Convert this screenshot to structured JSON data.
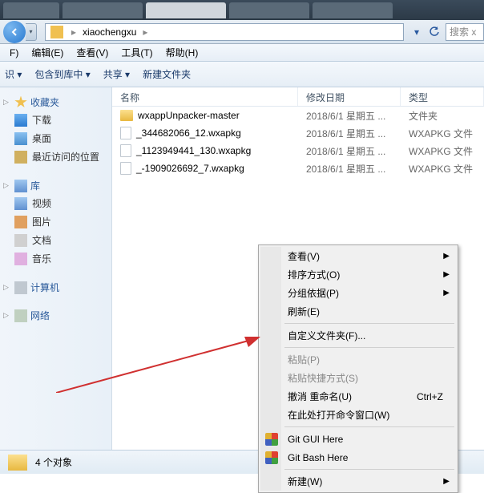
{
  "browser_tabs": [
    "",
    "",
    "",
    ""
  ],
  "breadcrumb": {
    "segment": "xiaochengxu",
    "sep": "▸"
  },
  "search_placeholder": "搜索 x",
  "menubar": [
    "F)",
    "编辑(E)",
    "查看(V)",
    "工具(T)",
    "帮助(H)"
  ],
  "toolbar": {
    "organize": "识 ▾",
    "include": "包含到库中 ▾",
    "share": "共享 ▾",
    "new_folder": "新建文件夹"
  },
  "sidebar": {
    "favorites": {
      "label": "收藏夹",
      "items": [
        "下载",
        "桌面",
        "最近访问的位置"
      ]
    },
    "libraries": {
      "label": "库",
      "items": [
        "视频",
        "图片",
        "文档",
        "音乐"
      ]
    },
    "computer": {
      "label": "计算机"
    },
    "network": {
      "label": "网络"
    }
  },
  "columns": {
    "name": "名称",
    "date": "修改日期",
    "type": "类型"
  },
  "files": [
    {
      "name": "wxappUnpacker-master",
      "date": "2018/6/1 星期五 ...",
      "type": "文件夹",
      "icon": "folder"
    },
    {
      "name": "_344682066_12.wxapkg",
      "date": "2018/6/1 星期五 ...",
      "type": "WXAPKG 文件",
      "icon": "file"
    },
    {
      "name": "_1123949441_130.wxapkg",
      "date": "2018/6/1 星期五 ...",
      "type": "WXAPKG 文件",
      "icon": "file"
    },
    {
      "name": "_-1909026692_7.wxapkg",
      "date": "2018/6/1 星期五 ...",
      "type": "WXAPKG 文件",
      "icon": "file"
    }
  ],
  "status": "4 个对象",
  "context_menu": {
    "view": "查看(V)",
    "sort": "排序方式(O)",
    "group": "分组依据(P)",
    "refresh": "刷新(E)",
    "customize": "自定义文件夹(F)...",
    "paste": "粘贴(P)",
    "paste_shortcut": "粘贴快捷方式(S)",
    "undo": "撤消 重命名(U)",
    "undo_key": "Ctrl+Z",
    "open_cmd": "在此处打开命令窗口(W)",
    "git_gui": "Git GUI Here",
    "git_bash": "Git Bash Here",
    "new": "新建(W)"
  }
}
